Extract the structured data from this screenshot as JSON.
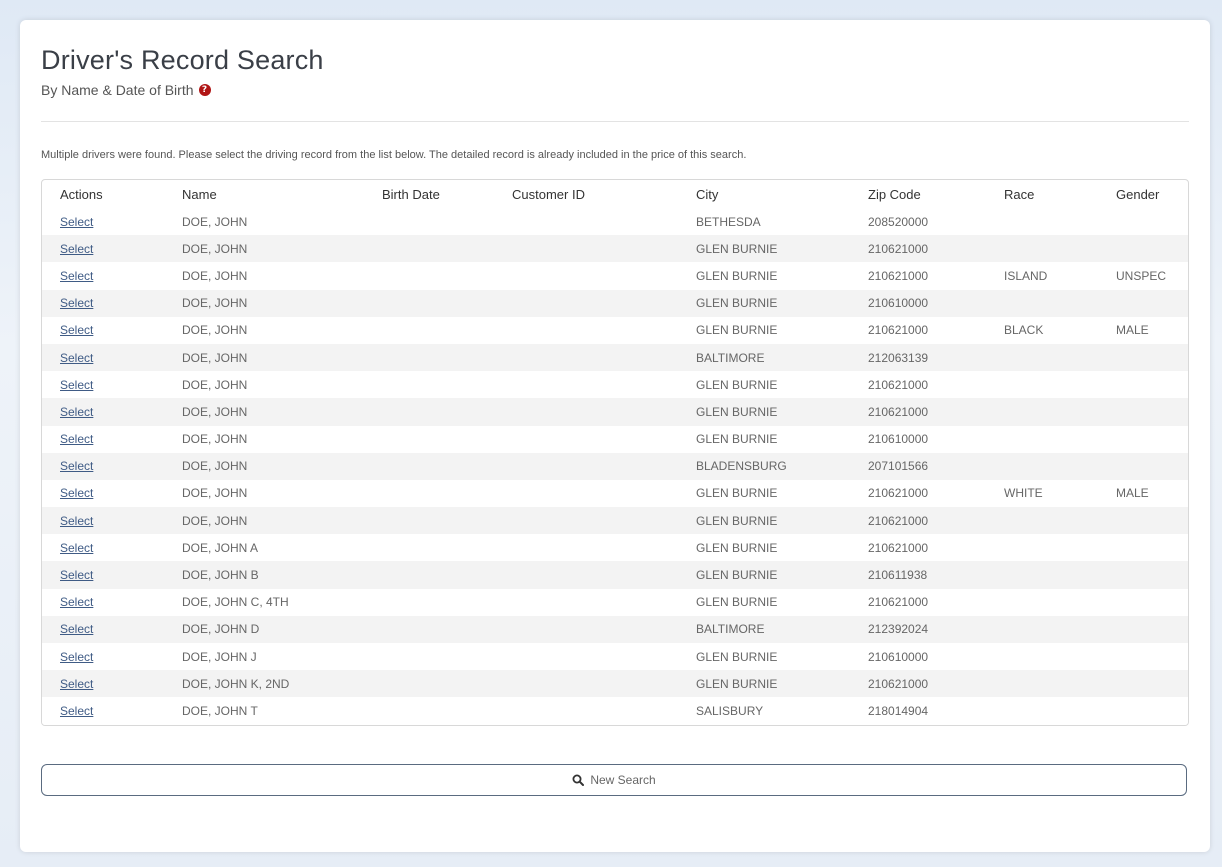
{
  "page": {
    "title": "Driver's Record Search",
    "subtitle": "By Name & Date of Birth",
    "help_icon": "question-circle-icon",
    "notice": "Multiple drivers were found. Please select the driving record from the list below. The detailed record is already included in the price of this search."
  },
  "table": {
    "headers": [
      "Actions",
      "Name",
      "Birth Date",
      "Customer ID",
      "City",
      "Zip Code",
      "Race",
      "Gender"
    ],
    "action_label": "Select",
    "rows": [
      {
        "name": "DOE, JOHN",
        "birth": "",
        "customer_id": "",
        "city": "BETHESDA",
        "zip": "208520000",
        "race": "",
        "gender": ""
      },
      {
        "name": "DOE, JOHN",
        "birth": "",
        "customer_id": "",
        "city": "GLEN BURNIE",
        "zip": "210621000",
        "race": "",
        "gender": ""
      },
      {
        "name": "DOE, JOHN",
        "birth": "",
        "customer_id": "",
        "city": "GLEN BURNIE",
        "zip": "210621000",
        "race": "ISLAND",
        "gender": "UNSPEC"
      },
      {
        "name": "DOE, JOHN",
        "birth": "",
        "customer_id": "",
        "city": "GLEN BURNIE",
        "zip": "210610000",
        "race": "",
        "gender": ""
      },
      {
        "name": "DOE, JOHN",
        "birth": "",
        "customer_id": "",
        "city": "GLEN BURNIE",
        "zip": "210621000",
        "race": "BLACK",
        "gender": "MALE"
      },
      {
        "name": "DOE, JOHN",
        "birth": "",
        "customer_id": "",
        "city": "BALTIMORE",
        "zip": "212063139",
        "race": "",
        "gender": ""
      },
      {
        "name": "DOE, JOHN",
        "birth": "",
        "customer_id": "",
        "city": "GLEN BURNIE",
        "zip": "210621000",
        "race": "",
        "gender": ""
      },
      {
        "name": "DOE, JOHN",
        "birth": "",
        "customer_id": "",
        "city": "GLEN BURNIE",
        "zip": "210621000",
        "race": "",
        "gender": ""
      },
      {
        "name": "DOE, JOHN",
        "birth": "",
        "customer_id": "",
        "city": "GLEN BURNIE",
        "zip": "210610000",
        "race": "",
        "gender": ""
      },
      {
        "name": "DOE, JOHN",
        "birth": "",
        "customer_id": "",
        "city": "BLADENSBURG",
        "zip": "207101566",
        "race": "",
        "gender": ""
      },
      {
        "name": "DOE, JOHN",
        "birth": "",
        "customer_id": "",
        "city": "GLEN BURNIE",
        "zip": "210621000",
        "race": "WHITE",
        "gender": "MALE"
      },
      {
        "name": "DOE, JOHN",
        "birth": "",
        "customer_id": "",
        "city": "GLEN BURNIE",
        "zip": "210621000",
        "race": "",
        "gender": ""
      },
      {
        "name": "DOE, JOHN A",
        "birth": "",
        "customer_id": "",
        "city": "GLEN BURNIE",
        "zip": "210621000",
        "race": "",
        "gender": ""
      },
      {
        "name": "DOE, JOHN B",
        "birth": "",
        "customer_id": "",
        "city": "GLEN BURNIE",
        "zip": "210611938",
        "race": "",
        "gender": ""
      },
      {
        "name": "DOE, JOHN C, 4TH",
        "birth": "",
        "customer_id": "",
        "city": "GLEN BURNIE",
        "zip": "210621000",
        "race": "",
        "gender": ""
      },
      {
        "name": "DOE, JOHN D",
        "birth": "",
        "customer_id": "",
        "city": "BALTIMORE",
        "zip": "212392024",
        "race": "",
        "gender": ""
      },
      {
        "name": "DOE, JOHN J",
        "birth": "",
        "customer_id": "",
        "city": "GLEN BURNIE",
        "zip": "210610000",
        "race": "",
        "gender": ""
      },
      {
        "name": "DOE, JOHN K, 2ND",
        "birth": "",
        "customer_id": "",
        "city": "GLEN BURNIE",
        "zip": "210621000",
        "race": "",
        "gender": ""
      },
      {
        "name": "DOE, JOHN T",
        "birth": "",
        "customer_id": "",
        "city": "SALISBURY",
        "zip": "218014904",
        "race": "",
        "gender": ""
      }
    ]
  },
  "new_search": {
    "label": "New Search",
    "icon": "search-icon"
  },
  "colors": {
    "link": "#3f5b85",
    "help_icon": "#b01515",
    "button_border": "#5a6b80"
  }
}
